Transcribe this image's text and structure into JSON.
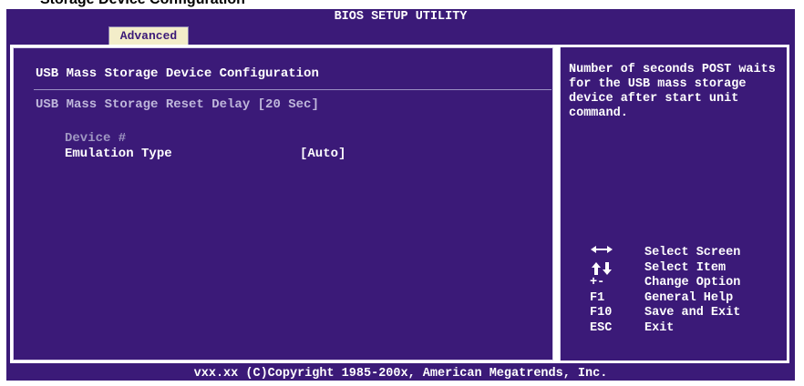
{
  "caption": "Storage Device Configuration",
  "header": {
    "title": "BIOS SETUP UTILITY",
    "active_tab": "Advanced"
  },
  "section": {
    "title": "USB Mass Storage Device Configuration"
  },
  "settings": {
    "reset_delay": "USB Mass Storage Reset Delay [20 Sec]",
    "device_label": "Device #",
    "emulation_label": "Emulation Type",
    "emulation_value": "[Auto]"
  },
  "help": {
    "text": "Number of seconds POST waits for the USB mass storage device after start unit command."
  },
  "keys": [
    {
      "icon": "left-right-arrow-icon",
      "desc": "Select Screen"
    },
    {
      "icon": "up-down-arrow-icon",
      "desc": "Select Item"
    },
    {
      "key": "+-",
      "desc": "Change Option"
    },
    {
      "key": "F1",
      "desc": "General Help"
    },
    {
      "key": "F10",
      "desc": "Save and Exit"
    },
    {
      "key": "ESC",
      "desc": "Exit"
    }
  ],
  "footer": {
    "text": "vxx.xx (C)Copyright 1985-200x, American Megatrends, Inc."
  },
  "colors": {
    "background": "#3b1a78",
    "tab_bg": "#f3edc9",
    "text": "#ffffff"
  }
}
